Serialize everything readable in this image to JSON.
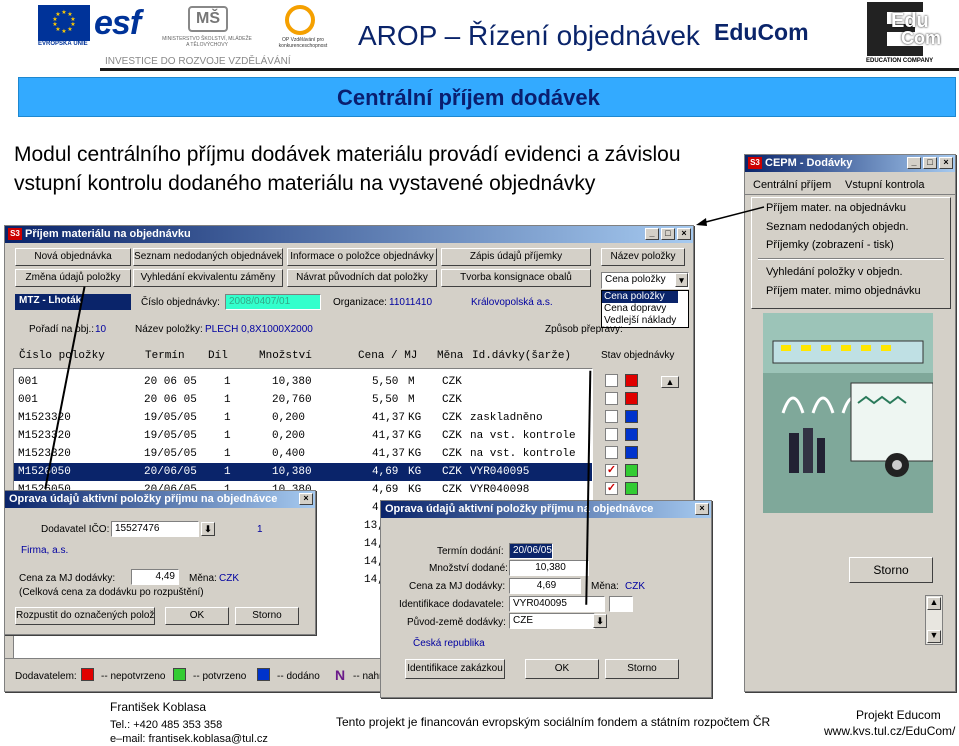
{
  "header": {
    "logo_eu": "EVROPSKÁ UNIE",
    "logo_esf": "esf",
    "logo_msmt": "MINISTERSTVO ŠKOLSTVÍ, MLÁDEŽE A TĚLOVÝCHOVY",
    "logo_op": "OP Vzdělávání pro konkurenceschopnost",
    "tagline": "INVESTICE DO ROZVOJE VZDĚLÁVÁNÍ",
    "title": "AROP – Řízení objednávek",
    "brand": "EduCom",
    "logo_educom_a": "Edu",
    "logo_educom_b": "Com",
    "logo_educom_caption": "EDUCATION COMPANY"
  },
  "banner": "Centrální příjem dodávek",
  "description": "Modul centrálního příjmu dodávek materiálu provádí evidenci a závislou vstupní kontrolu dodaného materiálu na vystavené objednávky",
  "cepm": {
    "icon": "S3",
    "title": "CEPM - Dodávky",
    "menu": [
      "Centrální příjem",
      "Vstupní kontrola"
    ],
    "items": [
      "Příjem mater. na objednávku",
      "Seznam nedodaných objedn.",
      "Příjemky (zobrazení - tisk)",
      "Vyhledání položky v objedn.",
      "Příjem mater. mimo objednávku"
    ],
    "close_button": "Storno"
  },
  "main": {
    "icon": "S3",
    "title": "Příjem materiálu na objednávku",
    "toolbar_row1": [
      "Nová objednávka",
      "Seznam nedodaných objednávek",
      "Informace o položce objednávky",
      "Zápis údajů příjemky",
      "Název položky"
    ],
    "toolbar_row2": [
      "Změna údajů položky",
      "Vyhledání ekvivalentu záměny",
      "Návrat původních dat položky",
      "Tvorba konsignace obalů"
    ],
    "sort": {
      "selected": "Cena položky",
      "options": [
        "Cena položky",
        "Cena dopravy",
        "Vedlejší náklady"
      ]
    },
    "info": {
      "unit": "MTZ - Lhoták",
      "order_label": "Číslo objednávky:",
      "order_value": "2008/0407/01",
      "org_label": "Organizace:",
      "org_value": "11011410",
      "org_name": "Královopolská a.s.",
      "pos_label": "Pořadí na obj.:",
      "pos_value": "10",
      "item_label": "Název položky:",
      "item_value": "PLECH 0,8X1000X2000",
      "transport_label": "Způsob přepravy:"
    },
    "columns": [
      "Číslo položky",
      "Termín",
      "Díl",
      "Množství",
      "Cena / MJ",
      "Měna",
      "Id.dávky(šarže)",
      "Stav objednávky"
    ],
    "rows": [
      [
        "001",
        "20 06 05",
        "1",
        "10,380",
        "5,50",
        "M",
        "CZK",
        ""
      ],
      [
        "001",
        "20 06 05",
        "1",
        "20,760",
        "5,50",
        "M",
        "CZK",
        ""
      ],
      [
        "M1523320",
        "19/05/05",
        "1",
        "0,200",
        "41,37",
        "KG",
        "CZK",
        "zaskladněno"
      ],
      [
        "M1523320",
        "19/05/05",
        "1",
        "0,200",
        "41,37",
        "KG",
        "CZK",
        "na vst. kontrole"
      ],
      [
        "M1523320",
        "19/05/05",
        "1",
        "0,400",
        "41,37",
        "KG",
        "CZK",
        "na vst. kontrole"
      ],
      [
        "M1526050",
        "20/06/05",
        "1",
        "10,380",
        "4,69",
        "KG",
        "CZK",
        "VYR040095"
      ],
      [
        "M1526050",
        "20/06/05",
        "1",
        "10,380",
        "4,69",
        "KG",
        "CZK",
        "VYR040098"
      ]
    ],
    "partial_rows": [
      "4,",
      "13,",
      "14,",
      "14,",
      "14,"
    ],
    "legend": {
      "label": "Dodavatelem:",
      "items": [
        "-- nepotvrzeno",
        "-- potvrzeno",
        "-- dodáno"
      ],
      "n_letter": "N",
      "n_text": "-- nahr"
    }
  },
  "dlg1": {
    "title": "Oprava údajů aktivní položky příjmu na objednávce",
    "supplier_label": "Dodavatel IČO:",
    "supplier_value": "15527476",
    "count": "1",
    "firm": "Firma, a.s.",
    "price_label": "Cena za MJ dodávky:",
    "price_value": "4,49",
    "currency_label": "Měna:",
    "currency_value": "CZK",
    "note": "(Celková cena za dodávku po rozpuštění)",
    "spread_button": "Rozpustit do označených položek",
    "ok_button": "OK",
    "cancel_button": "Storno"
  },
  "dlg2": {
    "title": "Oprava údajů aktivní položky příjmu na objednávce",
    "date_label": "Termín dodání:",
    "date_value": "20/06/05",
    "qty_label": "Množství dodané:",
    "qty_value": "10,380",
    "price_label": "Cena za MJ dodávky:",
    "price_value": "4,69",
    "currency_label": "Měna:",
    "currency_value": "CZK",
    "supplier_id_label": "Identifikace dodavatele:",
    "supplier_id_value": "VYR040095",
    "origin_label": "Původ-země dodávky:",
    "origin_value": "CZE",
    "country": "Česká republika",
    "identify_button": "Identifikace zakázkou",
    "ok_button": "OK",
    "cancel_button": "Storno"
  },
  "footer": {
    "author": "František Koblasa",
    "phone": "Tel.: +420 485 353 358",
    "email": "e–mail: frantisek.koblasa@tul.cz",
    "funding": "Tento projekt je financován evropským sociálním fondem a státním rozpočtem ČR",
    "project": "Projekt Educom",
    "url": "www.kvs.tul.cz/EduCom/"
  },
  "colors": {
    "banner": "#33aaff",
    "title_blue": "#0a246a",
    "selected_row": "#0a246a",
    "legend_red": "#e00000",
    "legend_green": "#33cc33",
    "legend_blue": "#0033cc"
  }
}
